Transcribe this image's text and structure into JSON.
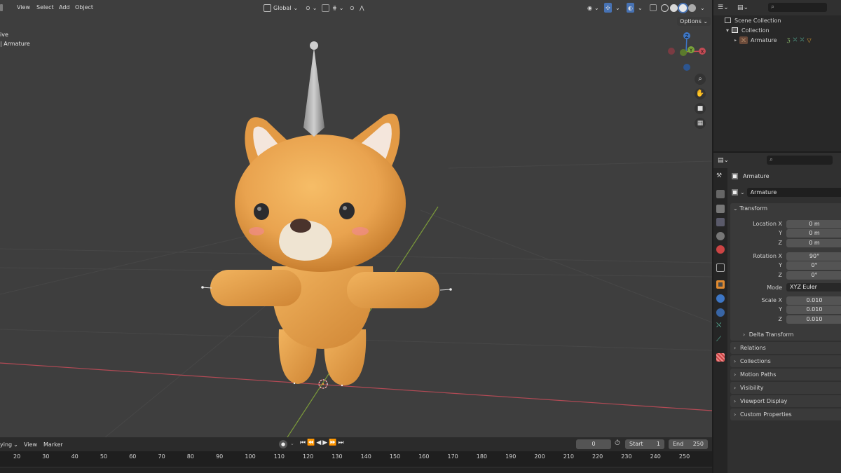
{
  "viewport_header": {
    "mode_partial": "",
    "menu": [
      "View",
      "Select",
      "Add",
      "Object"
    ],
    "orientation": "Global",
    "options_label": "Options"
  },
  "viewport_overlay": {
    "line1": "ive",
    "line2": "| Armature"
  },
  "gizmo": {
    "x": "X",
    "y": "Y",
    "z": "Z"
  },
  "outliner": {
    "scene_collection": "Scene Collection",
    "collection": "Collection",
    "armature": "Armature"
  },
  "properties": {
    "object_name": "Armature",
    "datablock_name": "Armature",
    "transform": {
      "title": "Transform",
      "location_x_label": "Location X",
      "location_x": "0 m",
      "location_y_label": "Y",
      "location_y": "0 m",
      "location_z_label": "Z",
      "location_z": "0 m",
      "rotation_x_label": "Rotation X",
      "rotation_x": "90°",
      "rotation_y_label": "Y",
      "rotation_y": "0°",
      "rotation_z_label": "Z",
      "rotation_z": "0°",
      "mode_label": "Mode",
      "mode": "XYZ Euler",
      "scale_x_label": "Scale X",
      "scale_x": "0.010",
      "scale_y_label": "Y",
      "scale_y": "0.010",
      "scale_z_label": "Z",
      "scale_z": "0.010",
      "delta_transform": "Delta Transform"
    },
    "panels": [
      "Relations",
      "Collections",
      "Motion Paths",
      "Visibility",
      "Viewport Display",
      "Custom Properties"
    ]
  },
  "timeline": {
    "playing_label": "ying",
    "view_label": "View",
    "marker_label": "Marker",
    "current_frame": "0",
    "start_label": "Start",
    "start_value": "1",
    "end_label": "End",
    "end_value": "250",
    "ticks": [
      "20",
      "30",
      "40",
      "50",
      "60",
      "70",
      "80",
      "90",
      "100",
      "110",
      "120",
      "130",
      "140",
      "150",
      "160",
      "170",
      "180",
      "190",
      "200",
      "210",
      "220",
      "230",
      "240",
      "250"
    ]
  },
  "colors": {
    "viewport_bg": "#3e3e3e",
    "panel_bg": "#303030",
    "field_bg": "#545454",
    "accent_blue": "#4772b3",
    "character_orange": "#e9a34f",
    "axis_red": "#b34a55",
    "axis_green": "#7b9a3a"
  }
}
